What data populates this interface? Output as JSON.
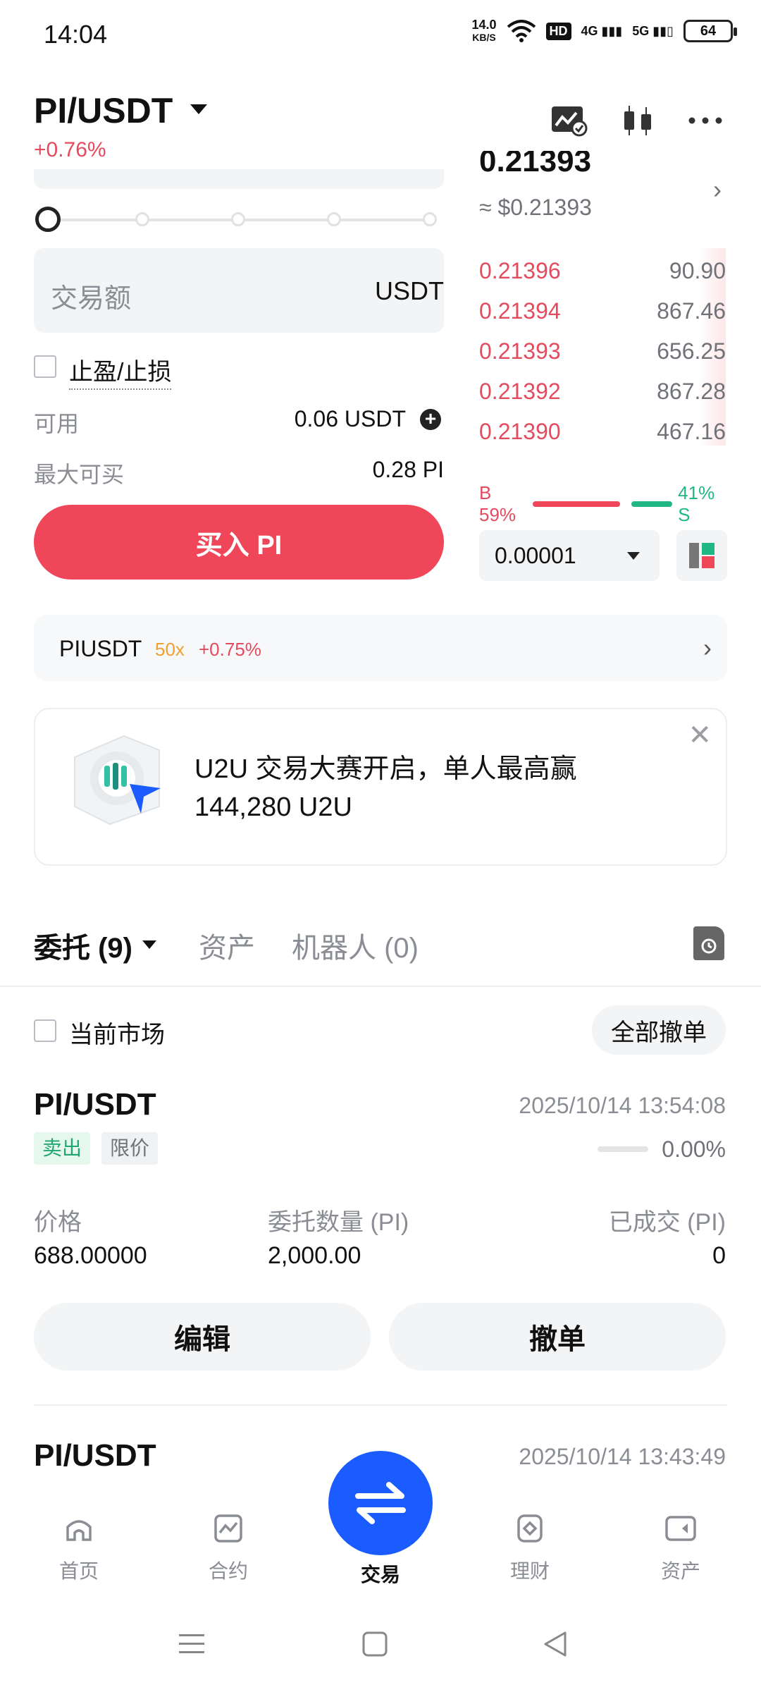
{
  "status_bar": {
    "time": "14:04",
    "net_speed_value": "14.0",
    "net_speed_unit": "KB/S",
    "hd": "HD",
    "sig4g": "4G",
    "sig5g": "5G",
    "battery": "64"
  },
  "header": {
    "pair": "PI/USDT",
    "change": "+0.76%",
    "icons": [
      "chart-settings-icon",
      "candlestick-icon",
      "more-icon"
    ]
  },
  "trade_panel": {
    "slider_level_percent": 0,
    "amount_placeholder": "交易额",
    "amount_unit": "USDT",
    "tpsl_label": "止盈/止损",
    "available_label": "可用",
    "available_value": "0.06 USDT",
    "max_buy_label": "最大可买",
    "max_buy_value": "0.28 PI",
    "buy_button": "买入 PI"
  },
  "order_book": {
    "last_price_partial": "0.21393",
    "approx_usd": "≈ $0.21393",
    "asks": [
      {
        "price": "0.21396",
        "qty": "90.90"
      },
      {
        "price": "0.21394",
        "qty": "867.46"
      },
      {
        "price": "0.21393",
        "qty": "656.25"
      },
      {
        "price": "0.21392",
        "qty": "867.28"
      },
      {
        "price": "0.21390",
        "qty": "467.16"
      }
    ],
    "buy_ratio_label": "B 59%",
    "sell_ratio_label": "41% S",
    "buy_ratio": 59,
    "sell_ratio": 41,
    "tick_size": "0.00001"
  },
  "futures_link": {
    "symbol": "PIUSDT",
    "leverage": "50x",
    "change": "+0.75%"
  },
  "promo": {
    "line1": "U2U 交易大赛开启，单人最高赢",
    "line2": "144,280 U2U"
  },
  "tabs": {
    "orders": "委托 (9)",
    "assets": "资产",
    "bots": "机器人 (0)"
  },
  "filter": {
    "current_market": "当前市场",
    "cancel_all": "全部撤单"
  },
  "orders": [
    {
      "pair": "PI/USDT",
      "time": "2025/10/14 13:54:08",
      "side": "卖出",
      "type": "限价",
      "fill_percent": "0.00%",
      "price_label": "价格",
      "price": "688.00000",
      "qty_label": "委托数量 (PI)",
      "qty": "2,000.00",
      "filled_label": "已成交 (PI)",
      "filled": "0",
      "edit": "编辑",
      "cancel": "撤单"
    },
    {
      "pair": "PI/USDT",
      "time": "2025/10/14 13:43:49"
    }
  ],
  "bottom_nav": {
    "home": "首页",
    "futures": "合约",
    "trade": "交易",
    "earn": "理财",
    "assets": "资产"
  },
  "colors": {
    "red": "#f0465a",
    "green": "#21b784",
    "blue": "#1a5cff"
  }
}
